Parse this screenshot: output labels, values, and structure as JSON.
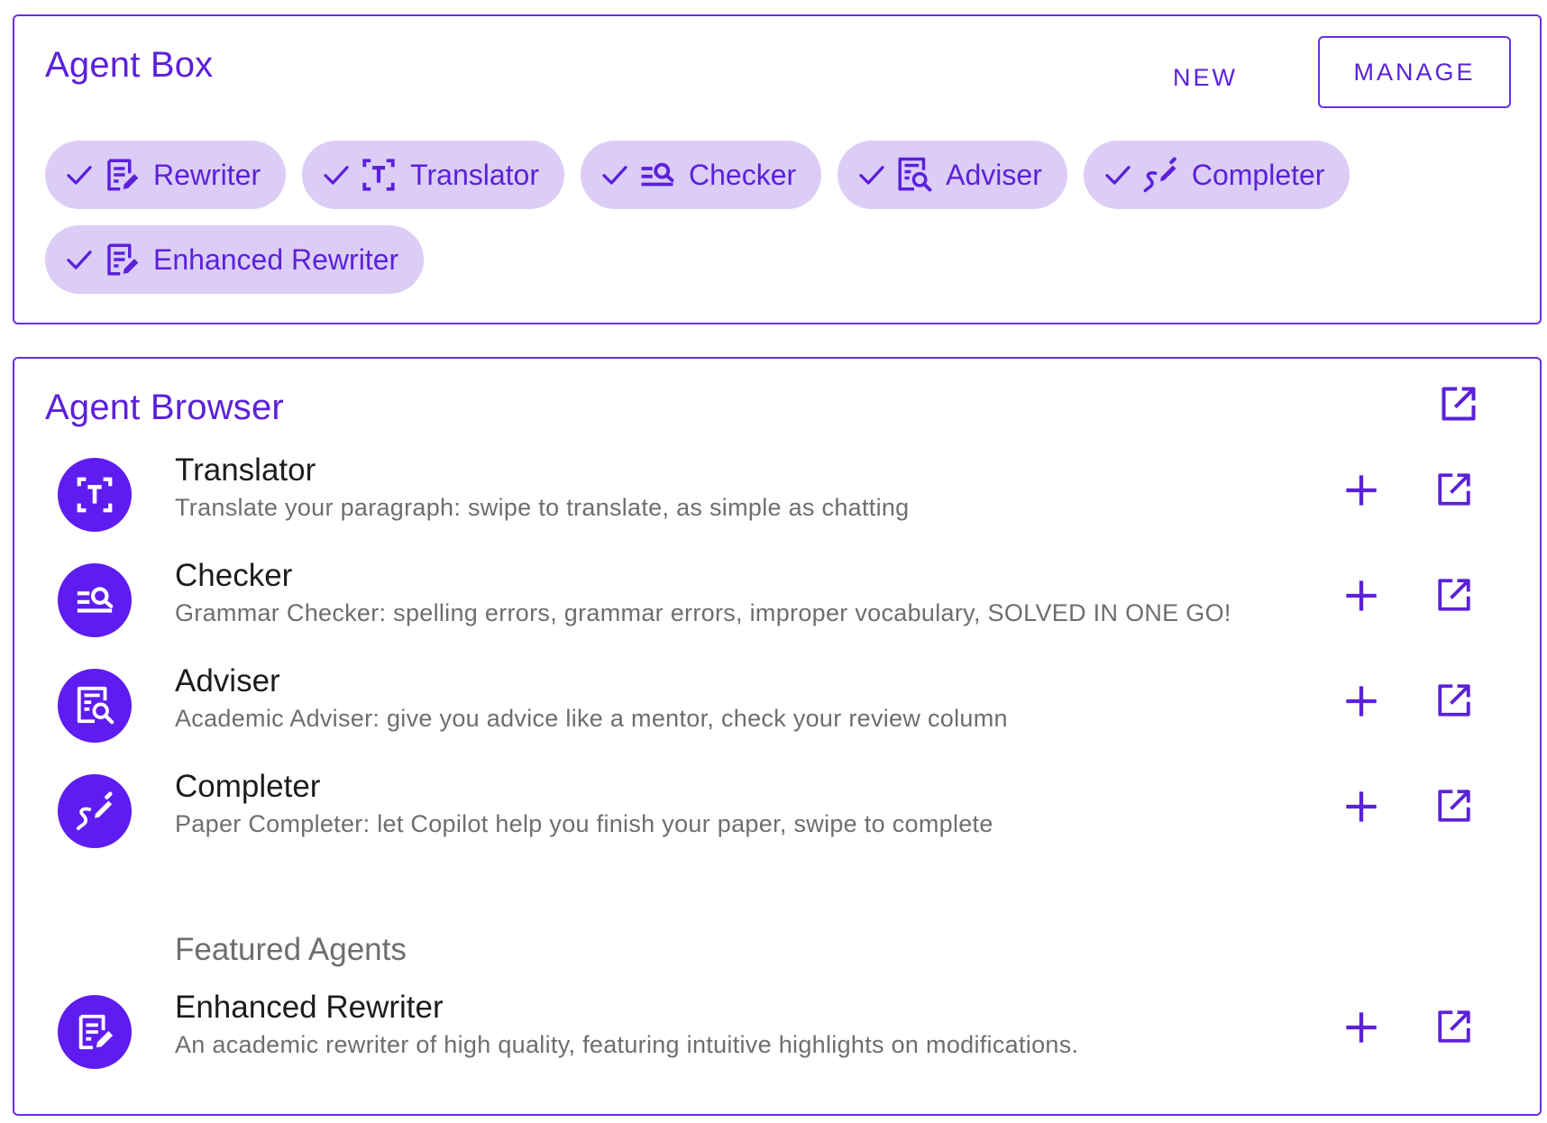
{
  "agent_box": {
    "title": "Agent Box",
    "new_label": "NEW",
    "manage_label": "MANAGE",
    "chips": [
      {
        "label": "Rewriter",
        "icon": "rewriter-icon"
      },
      {
        "label": "Translator",
        "icon": "translator-icon"
      },
      {
        "label": "Checker",
        "icon": "checker-icon"
      },
      {
        "label": "Adviser",
        "icon": "adviser-icon"
      },
      {
        "label": "Completer",
        "icon": "completer-icon"
      },
      {
        "label": "Enhanced Rewriter",
        "icon": "rewriter-icon"
      }
    ]
  },
  "agent_browser": {
    "title": "Agent Browser",
    "agents": [
      {
        "name": "Translator",
        "description": "Translate your paragraph: swipe to translate, as simple as chatting",
        "icon": "translator-icon"
      },
      {
        "name": "Checker",
        "description": "Grammar Checker: spelling errors, grammar errors, improper vocabulary, SOLVED IN ONE GO!",
        "icon": "checker-icon"
      },
      {
        "name": "Adviser",
        "description": "Academic Adviser: give you advice like a mentor, check your review column",
        "icon": "adviser-icon"
      },
      {
        "name": "Completer",
        "description": "Paper Completer: let Copilot help you finish your paper, swipe to complete",
        "icon": "completer-icon"
      }
    ],
    "featured_heading": "Featured Agents",
    "featured": [
      {
        "name": "Enhanced Rewriter",
        "description": "An academic rewriter of high quality, featuring intuitive highlights on modifications.",
        "icon": "rewriter-icon"
      }
    ]
  },
  "colors": {
    "accent": "#5b21d9",
    "chip_bg": "#dccdf7",
    "avatar_bg": "#5e1cf0",
    "border": "#6a2ee0"
  }
}
